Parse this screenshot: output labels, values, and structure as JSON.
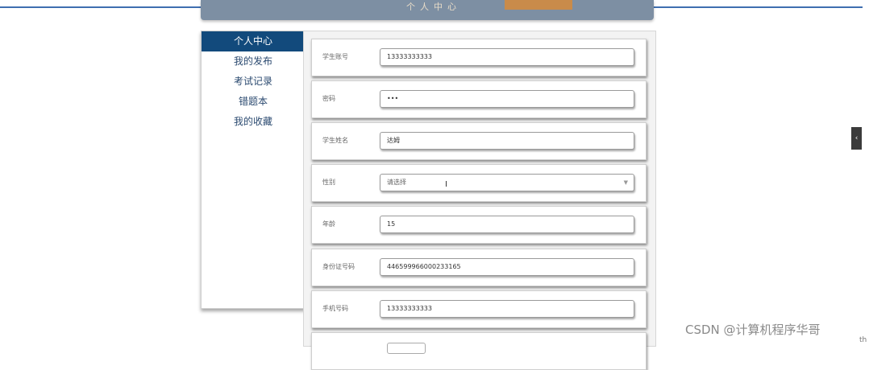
{
  "banner": {
    "text": "个人中心"
  },
  "sidebar": {
    "items": [
      {
        "label": "个人中心",
        "active": true
      },
      {
        "label": "我的发布",
        "active": false
      },
      {
        "label": "考试记录",
        "active": false
      },
      {
        "label": "错题本",
        "active": false
      },
      {
        "label": "我的收藏",
        "active": false
      }
    ]
  },
  "form": {
    "fields": [
      {
        "label": "学生账号",
        "value": "13333333333"
      },
      {
        "label": "密码",
        "value": "•••"
      },
      {
        "label": "学生姓名",
        "value": "达姆"
      },
      {
        "label": "性别",
        "value": "请选择",
        "type": "select"
      },
      {
        "label": "年龄",
        "value": "15"
      },
      {
        "label": "身份证号码",
        "value": "446599966000233165"
      },
      {
        "label": "手机号码",
        "value": "13333333333"
      }
    ]
  },
  "handle": {
    "glyph": "‹"
  },
  "watermark": {
    "text": "CSDN @计算机程序华哥"
  },
  "stray": {
    "text": "th"
  },
  "colors": {
    "accent": "#124a7c",
    "banner": "#7d8fa3",
    "orange": "#c98b4a"
  }
}
